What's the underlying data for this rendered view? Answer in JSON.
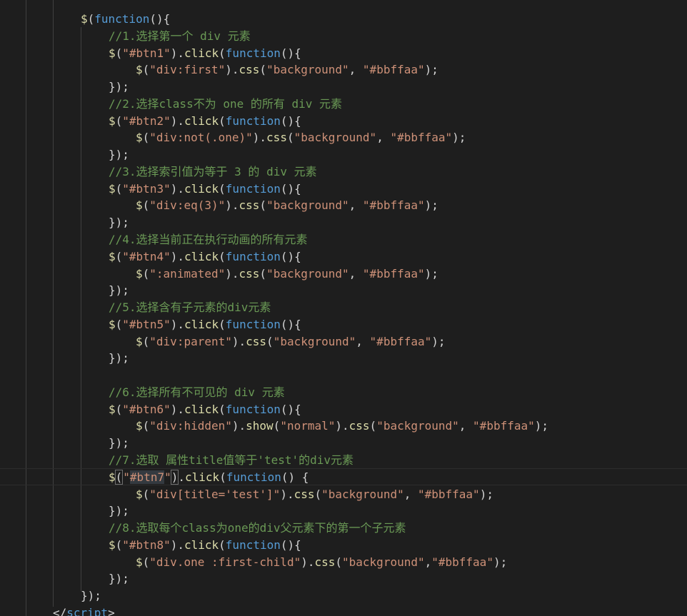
{
  "editor": {
    "lines": [
      [
        [
          "$",
          "fn"
        ],
        [
          "(",
          "punc"
        ],
        [
          "function",
          "kw"
        ],
        [
          "(){",
          "punc"
        ]
      ],
      [
        [
          "//1.选择第一个 div 元素",
          "cmt"
        ]
      ],
      [
        [
          "$",
          "fn"
        ],
        [
          "(",
          "punc"
        ],
        [
          "\"#btn1\"",
          "str"
        ],
        [
          ").",
          "punc"
        ],
        [
          "click",
          "fn"
        ],
        [
          "(",
          "punc"
        ],
        [
          "function",
          "kw"
        ],
        [
          "(){",
          "punc"
        ]
      ],
      [
        [
          "$",
          "fn"
        ],
        [
          "(",
          "punc"
        ],
        [
          "\"div:first\"",
          "str"
        ],
        [
          ").",
          "punc"
        ],
        [
          "css",
          "fn"
        ],
        [
          "(",
          "punc"
        ],
        [
          "\"background\"",
          "str"
        ],
        [
          ", ",
          "punc"
        ],
        [
          "\"#bbffaa\"",
          "str"
        ],
        [
          ");",
          "punc"
        ]
      ],
      [
        [
          "});",
          "punc"
        ]
      ],
      [
        [
          "//2.选择class不为 one 的所有 div 元素",
          "cmt"
        ]
      ],
      [
        [
          "$",
          "fn"
        ],
        [
          "(",
          "punc"
        ],
        [
          "\"#btn2\"",
          "str"
        ],
        [
          ").",
          "punc"
        ],
        [
          "click",
          "fn"
        ],
        [
          "(",
          "punc"
        ],
        [
          "function",
          "kw"
        ],
        [
          "(){",
          "punc"
        ]
      ],
      [
        [
          "$",
          "fn"
        ],
        [
          "(",
          "punc"
        ],
        [
          "\"div:not(.one)\"",
          "str"
        ],
        [
          ").",
          "punc"
        ],
        [
          "css",
          "fn"
        ],
        [
          "(",
          "punc"
        ],
        [
          "\"background\"",
          "str"
        ],
        [
          ", ",
          "punc"
        ],
        [
          "\"#bbffaa\"",
          "str"
        ],
        [
          ");",
          "punc"
        ]
      ],
      [
        [
          "});",
          "punc"
        ]
      ],
      [
        [
          "//3.选择索引值为等于 3 的 div 元素",
          "cmt"
        ]
      ],
      [
        [
          "$",
          "fn"
        ],
        [
          "(",
          "punc"
        ],
        [
          "\"#btn3\"",
          "str"
        ],
        [
          ").",
          "punc"
        ],
        [
          "click",
          "fn"
        ],
        [
          "(",
          "punc"
        ],
        [
          "function",
          "kw"
        ],
        [
          "(){",
          "punc"
        ]
      ],
      [
        [
          "$",
          "fn"
        ],
        [
          "(",
          "punc"
        ],
        [
          "\"div:eq(3)\"",
          "str"
        ],
        [
          ").",
          "punc"
        ],
        [
          "css",
          "fn"
        ],
        [
          "(",
          "punc"
        ],
        [
          "\"background\"",
          "str"
        ],
        [
          ", ",
          "punc"
        ],
        [
          "\"#bbffaa\"",
          "str"
        ],
        [
          ");",
          "punc"
        ]
      ],
      [
        [
          "});",
          "punc"
        ]
      ],
      [
        [
          "//4.选择当前正在执行动画的所有元素",
          "cmt"
        ]
      ],
      [
        [
          "$",
          "fn"
        ],
        [
          "(",
          "punc"
        ],
        [
          "\"#btn4\"",
          "str"
        ],
        [
          ").",
          "punc"
        ],
        [
          "click",
          "fn"
        ],
        [
          "(",
          "punc"
        ],
        [
          "function",
          "kw"
        ],
        [
          "(){",
          "punc"
        ]
      ],
      [
        [
          "$",
          "fn"
        ],
        [
          "(",
          "punc"
        ],
        [
          "\":animated\"",
          "str"
        ],
        [
          ").",
          "punc"
        ],
        [
          "css",
          "fn"
        ],
        [
          "(",
          "punc"
        ],
        [
          "\"background\"",
          "str"
        ],
        [
          ", ",
          "punc"
        ],
        [
          "\"#bbffaa\"",
          "str"
        ],
        [
          ");",
          "punc"
        ]
      ],
      [
        [
          "});",
          "punc"
        ]
      ],
      [
        [
          "//5.选择含有子元素的div元素",
          "cmt"
        ]
      ],
      [
        [
          "$",
          "fn"
        ],
        [
          "(",
          "punc"
        ],
        [
          "\"#btn5\"",
          "str"
        ],
        [
          ").",
          "punc"
        ],
        [
          "click",
          "fn"
        ],
        [
          "(",
          "punc"
        ],
        [
          "function",
          "kw"
        ],
        [
          "(){",
          "punc"
        ]
      ],
      [
        [
          "$",
          "fn"
        ],
        [
          "(",
          "punc"
        ],
        [
          "\"div:parent\"",
          "str"
        ],
        [
          ").",
          "punc"
        ],
        [
          "css",
          "fn"
        ],
        [
          "(",
          "punc"
        ],
        [
          "\"background\"",
          "str"
        ],
        [
          ", ",
          "punc"
        ],
        [
          "\"#bbffaa\"",
          "str"
        ],
        [
          ");",
          "punc"
        ]
      ],
      [
        [
          "});",
          "punc"
        ]
      ],
      [],
      [
        [
          "//6.选择所有不可见的 div 元素",
          "cmt"
        ]
      ],
      [
        [
          "$",
          "fn"
        ],
        [
          "(",
          "punc"
        ],
        [
          "\"#btn6\"",
          "str"
        ],
        [
          ").",
          "punc"
        ],
        [
          "click",
          "fn"
        ],
        [
          "(",
          "punc"
        ],
        [
          "function",
          "kw"
        ],
        [
          "(){",
          "punc"
        ]
      ],
      [
        [
          "$",
          "fn"
        ],
        [
          "(",
          "punc"
        ],
        [
          "\"div:hidden\"",
          "str"
        ],
        [
          ").",
          "punc"
        ],
        [
          "show",
          "fn"
        ],
        [
          "(",
          "punc"
        ],
        [
          "\"normal\"",
          "str"
        ],
        [
          ").",
          "punc"
        ],
        [
          "css",
          "fn"
        ],
        [
          "(",
          "punc"
        ],
        [
          "\"background\"",
          "str"
        ],
        [
          ", ",
          "punc"
        ],
        [
          "\"#bbffaa\"",
          "str"
        ],
        [
          ");",
          "punc"
        ]
      ],
      [
        [
          "});",
          "punc"
        ]
      ],
      [
        [
          "//7.选取 属性title值等于'test'的div元素",
          "cmt"
        ]
      ],
      [
        [
          "$",
          "fn"
        ],
        [
          "(",
          "punc"
        ],
        [
          "\"",
          "str"
        ],
        [
          "#btn7",
          "str"
        ],
        [
          "\"",
          "str"
        ],
        [
          ")",
          "punc"
        ],
        [
          ".",
          "punc"
        ],
        [
          "click",
          "fn"
        ],
        [
          "(",
          "punc"
        ],
        [
          "function",
          "kw"
        ],
        [
          "() {",
          "punc"
        ]
      ],
      [
        [
          "$",
          "fn"
        ],
        [
          "(",
          "punc"
        ],
        [
          "\"div[title='test']\"",
          "str"
        ],
        [
          ").",
          "punc"
        ],
        [
          "css",
          "fn"
        ],
        [
          "(",
          "punc"
        ],
        [
          "\"background\"",
          "str"
        ],
        [
          ", ",
          "punc"
        ],
        [
          "\"#bbffaa\"",
          "str"
        ],
        [
          ");",
          "punc"
        ]
      ],
      [
        [
          "});",
          "punc"
        ]
      ],
      [
        [
          "//8.选取每个class为one的div父元素下的第一个子元素",
          "cmt"
        ]
      ],
      [
        [
          "$",
          "fn"
        ],
        [
          "(",
          "punc"
        ],
        [
          "\"#btn8\"",
          "str"
        ],
        [
          ").",
          "punc"
        ],
        [
          "click",
          "fn"
        ],
        [
          "(",
          "punc"
        ],
        [
          "function",
          "kw"
        ],
        [
          "(){",
          "punc"
        ]
      ],
      [
        [
          "$",
          "fn"
        ],
        [
          "(",
          "punc"
        ],
        [
          "\"div.one :first-child\"",
          "str"
        ],
        [
          ").",
          "punc"
        ],
        [
          "css",
          "fn"
        ],
        [
          "(",
          "punc"
        ],
        [
          "\"background\"",
          "str"
        ],
        [
          ",",
          "punc"
        ],
        [
          "\"#bbffaa\"",
          "str"
        ],
        [
          ");",
          "punc"
        ]
      ],
      [
        [
          "});",
          "punc"
        ]
      ],
      [
        [
          "});",
          "punc"
        ]
      ],
      [
        [
          "</",
          "punc"
        ],
        [
          "script",
          "tag"
        ],
        [
          ">",
          "punc"
        ]
      ]
    ],
    "colors": {
      "background": "#1e1e1e",
      "text": "#d4d4d4",
      "function": "#dcdcaa",
      "string": "#ce9178",
      "keyword": "#569cd6",
      "comment": "#6a9955",
      "indent_guide": "#404040"
    }
  }
}
